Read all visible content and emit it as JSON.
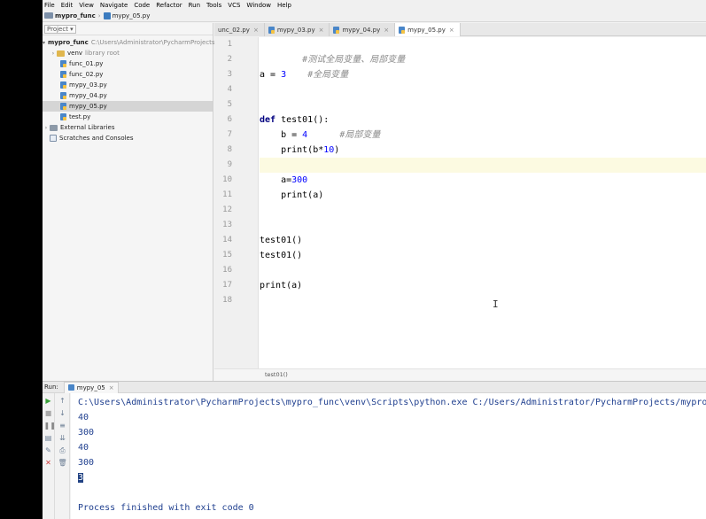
{
  "menu": [
    "File",
    "Edit",
    "View",
    "Navigate",
    "Code",
    "Refactor",
    "Run",
    "Tools",
    "VCS",
    "Window",
    "Help"
  ],
  "navbar": {
    "project": "mypro_func",
    "file": "mypy_05.py"
  },
  "sidebar": {
    "header": "Project",
    "root_name": "mypro_func",
    "root_path": "C:\\Users\\Administrator\\PycharmProjects",
    "venv": "venv",
    "venv_note": "library root",
    "files": [
      "func_01.py",
      "func_02.py",
      "mypy_03.py",
      "mypy_04.py",
      "mypy_05.py",
      "test.py"
    ],
    "external": "External Libraries",
    "scratches": "Scratches and Consoles"
  },
  "tabs": [
    "unc_02.py",
    "mypy_03.py",
    "mypy_04.py",
    "mypy_05.py"
  ],
  "editor": {
    "line_numbers": [
      "1",
      "2",
      "3",
      "4",
      "5",
      "6",
      "7",
      "8",
      "9",
      "10",
      "11",
      "12",
      "13",
      "14",
      "15",
      "16",
      "17",
      "18"
    ],
    "l1_comment": "#测试全局变量、局部变量",
    "l3_code": "a = ",
    "l3_num": "3",
    "l3_comment": "#全局变量",
    "l6_kw": "def",
    "l6_rest": " test01():",
    "l7_code": "    b = ",
    "l7_num": "4",
    "l7_comment": "#局部变量",
    "l8_code": "    print(b*",
    "l8_num": "10",
    "l8_end": ")",
    "l10_code": "    a=",
    "l10_num": "300",
    "l11_code": "    print(a)",
    "l14_code": "test01()",
    "l15_code": "test01()",
    "l17_code": "print(a)",
    "breadcrumb": "test01()"
  },
  "run": {
    "label": "Run:",
    "tab": "mypy_05",
    "command": "C:\\Users\\Administrator\\PycharmProjects\\mypro_func\\venv\\Scripts\\python.exe C:/Users/Administrator/PycharmProjects/mypro_func/mypy_05.py",
    "output": [
      "40",
      "300",
      "40",
      "300",
      "3"
    ],
    "exit_message": "Process finished with exit code 0"
  },
  "colors": {
    "keyword": "#000080",
    "number": "#0000ff",
    "comment": "#8c8c8c",
    "console_text": "#1f3f8f",
    "current_line": "#fcfae1"
  }
}
